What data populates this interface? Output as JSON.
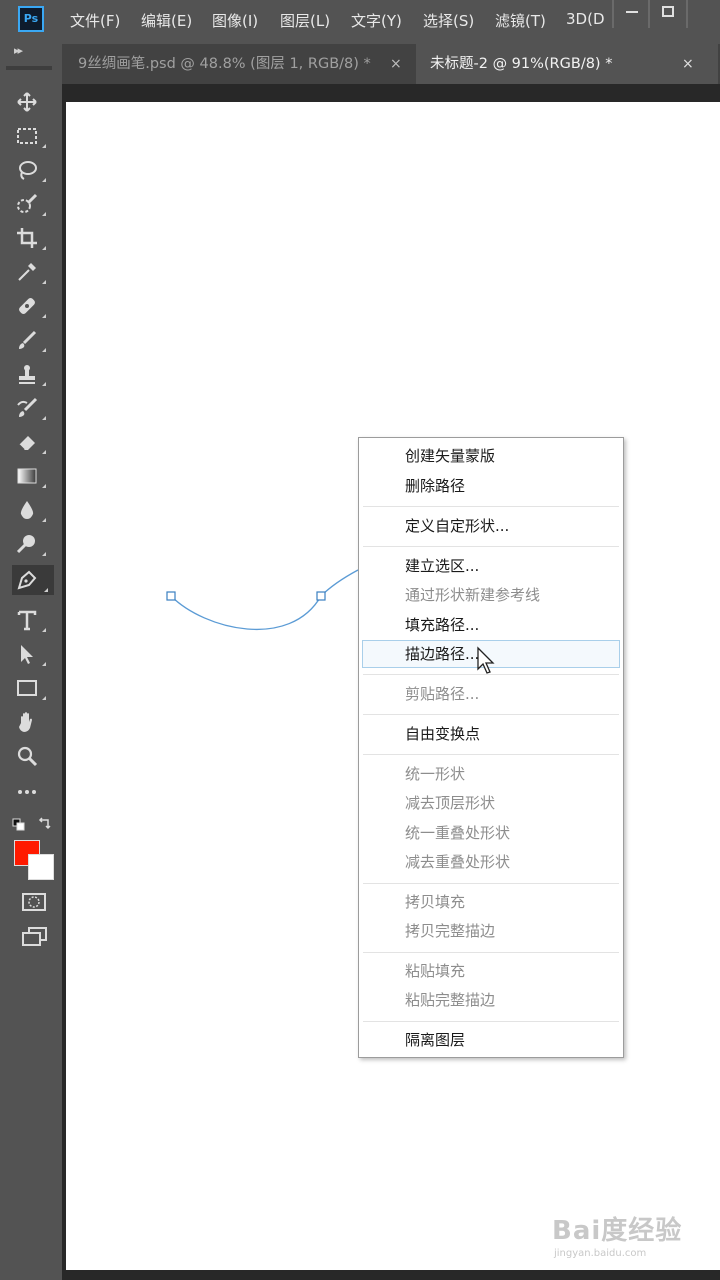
{
  "app": {
    "logo_text": "Ps"
  },
  "menubar": {
    "items": [
      "文件(F)",
      "编辑(E)",
      "图像(I)",
      "图层(L)",
      "文字(Y)",
      "选择(S)",
      "滤镜(T)",
      "3D(D"
    ]
  },
  "tabs": [
    {
      "label": "9丝绸画笔.psd @ 48.8% (图层 1, RGB/8) *",
      "close": "×",
      "active": false
    },
    {
      "label": "未标题-2 @ 91%(RGB/8) *",
      "close": "×",
      "active": true
    }
  ],
  "tools": [
    "move-tool",
    "marquee-tool",
    "lasso-tool",
    "quick-selection-tool",
    "crop-tool",
    "eyedropper-tool",
    "healing-brush-tool",
    "brush-tool",
    "clone-stamp-tool",
    "history-brush-tool",
    "eraser-tool",
    "gradient-tool",
    "blur-tool",
    "dodge-tool",
    "pen-tool",
    "type-tool",
    "path-selection-tool",
    "rectangle-tool",
    "hand-tool",
    "zoom-tool",
    "more-tools"
  ],
  "colors": {
    "foreground": "#ff1a00",
    "background": "#ffffff",
    "path": "#5b9bd5"
  },
  "context_menu": {
    "items": [
      {
        "label": "创建矢量蒙版",
        "enabled": true
      },
      {
        "label": "删除路径",
        "enabled": true
      },
      {
        "label": "定义自定形状...",
        "enabled": true
      },
      {
        "label": "建立选区...",
        "enabled": true
      },
      {
        "label": "通过形状新建参考线",
        "enabled": false
      },
      {
        "label": "填充路径...",
        "enabled": true
      },
      {
        "label": "描边路径...",
        "enabled": true,
        "hovered": true
      },
      {
        "label": "剪贴路径...",
        "enabled": false
      },
      {
        "label": "自由变换点",
        "enabled": true
      },
      {
        "label": "统一形状",
        "enabled": false
      },
      {
        "label": "减去顶层形状",
        "enabled": false
      },
      {
        "label": "统一重叠处形状",
        "enabled": false
      },
      {
        "label": "减去重叠处形状",
        "enabled": false
      },
      {
        "label": "拷贝填充",
        "enabled": false
      },
      {
        "label": "拷贝完整描边",
        "enabled": false
      },
      {
        "label": "粘贴填充",
        "enabled": false
      },
      {
        "label": "粘贴完整描边",
        "enabled": false
      },
      {
        "label": "隔离图层",
        "enabled": true
      }
    ]
  },
  "watermark": {
    "brand": "Bai度经验",
    "url": "jingyan.baidu.com"
  }
}
